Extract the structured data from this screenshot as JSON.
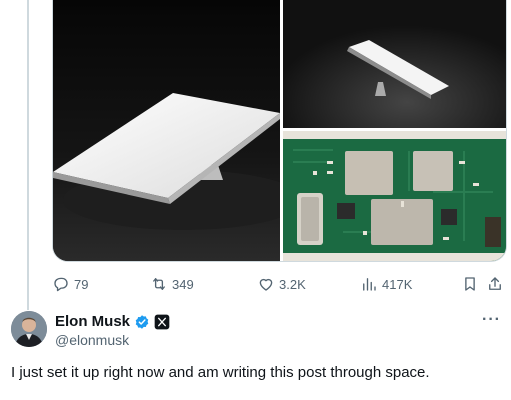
{
  "post": {
    "stats": {
      "replies": "79",
      "reposts": "349",
      "likes": "3.2K",
      "views": "417K"
    }
  },
  "reply": {
    "author": {
      "display_name": "Elon Musk",
      "handle": "@elonmusk",
      "verified": true,
      "affiliate_badge": "x-logo-icon"
    },
    "text": "I just set it up right now and am writing this post through space."
  },
  "icons": {
    "reply": "comment-icon",
    "repost": "repost-icon",
    "like": "heart-icon",
    "views": "views-icon",
    "bookmark": "bookmark-icon",
    "share": "share-icon",
    "more": "more-icon",
    "verified": "verified-icon"
  },
  "colors": {
    "text": "#0f1419",
    "secondary": "#536471",
    "verified_blue": "#1d9bf0",
    "border": "#cfd9de"
  }
}
